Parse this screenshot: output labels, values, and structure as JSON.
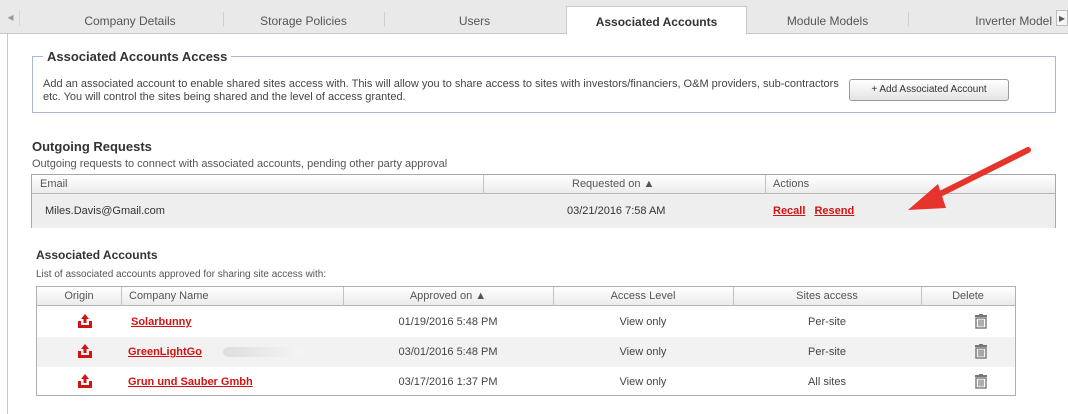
{
  "tabs": [
    {
      "label": "Company Details",
      "active": false
    },
    {
      "label": "Storage Policies",
      "active": false
    },
    {
      "label": "Users",
      "active": false
    },
    {
      "label": "Associated Accounts",
      "active": true
    },
    {
      "label": "Module Models",
      "active": false
    },
    {
      "label": "Inverter Model",
      "active": false
    }
  ],
  "tab_scroll": {
    "left_glyph": "◂",
    "right_glyph": "▸"
  },
  "access": {
    "legend": "Associated Accounts Access",
    "description": "Add an associated account to enable shared sites access with. This will allow you to share access to sites with investors/financiers, O&M providers, sub-contractors etc. You will control the sites being shared and the level of access granted.",
    "add_button": "+ Add Associated Account"
  },
  "outgoing": {
    "title": "Outgoing Requests",
    "subtitle": "Outgoing requests to connect with associated accounts, pending other party approval",
    "columns": {
      "email": "Email",
      "requested_on": "Requested on ▲",
      "actions": "Actions"
    },
    "rows": [
      {
        "email": "Miles.Davis@Gmail.com",
        "requested_on": "03/21/2016 7:58 AM",
        "recall": "Recall",
        "resend": "Resend"
      }
    ]
  },
  "associated": {
    "title": "Associated Accounts",
    "subtitle": "List of associated accounts approved for sharing site access with:",
    "columns": {
      "origin": "Origin",
      "company": "Company Name",
      "approved_on": "Approved on ▲",
      "access_level": "Access Level",
      "sites_access": "Sites access",
      "delete": "Delete"
    },
    "rows": [
      {
        "origin_icon": "outgoing-share-icon",
        "company": "Solarbunny",
        "approved_on": "01/19/2016 5:48 PM",
        "access_level": "View only",
        "sites_access": "Per-site",
        "delete_icon": "trash-icon"
      },
      {
        "origin_icon": "outgoing-share-icon",
        "company": "GreenLightGo",
        "approved_on": "03/01/2016 5:48 PM",
        "access_level": "View only",
        "sites_access": "Per-site",
        "delete_icon": "trash-icon"
      },
      {
        "origin_icon": "outgoing-share-icon",
        "company": "Grun und Sauber Gmbh",
        "approved_on": "03/17/2016 1:37 PM",
        "access_level": "View only",
        "sites_access": "All sites",
        "delete_icon": "trash-icon"
      }
    ]
  },
  "colors": {
    "link_red": "#d41212",
    "arrow_red": "#e5342b",
    "fieldset_border": "#aab6d6"
  }
}
